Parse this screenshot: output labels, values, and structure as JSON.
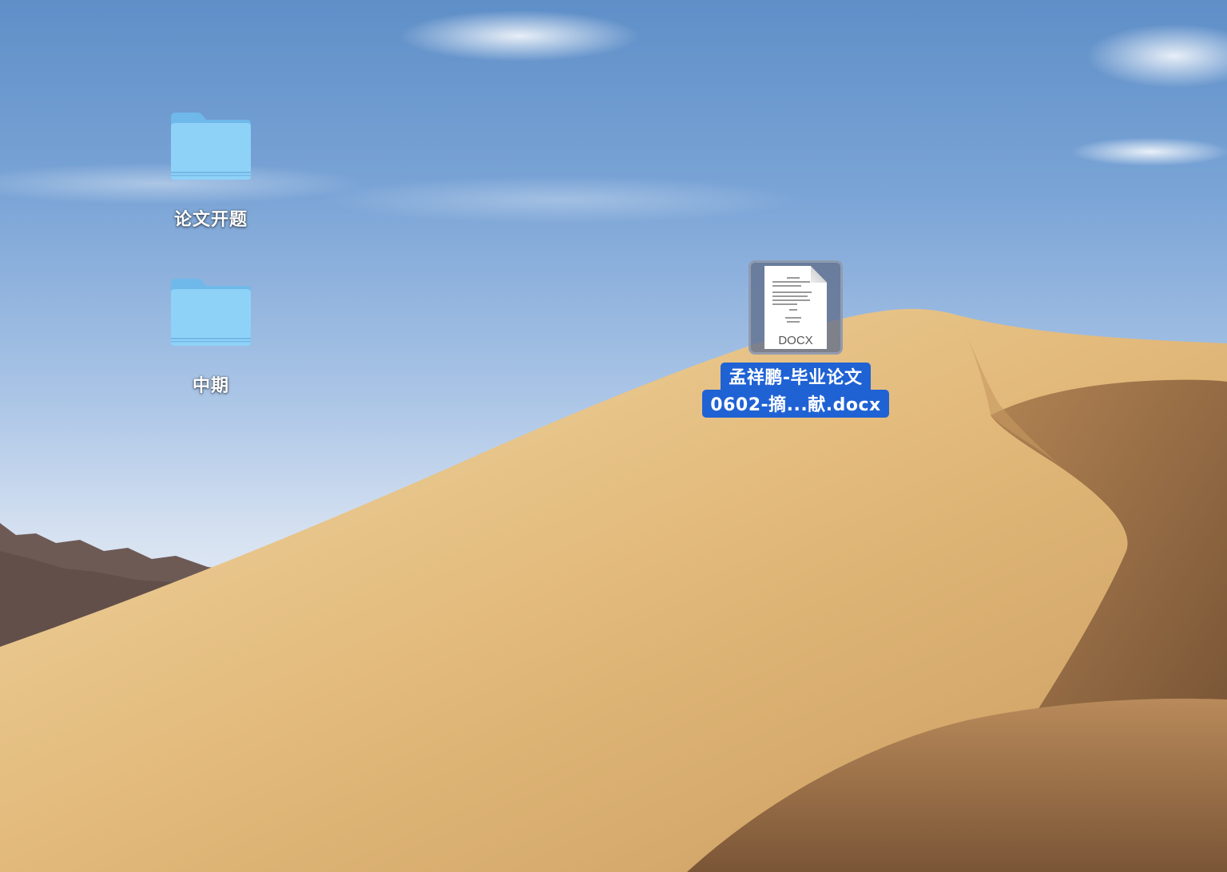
{
  "desktop": {
    "icons": [
      {
        "label": "论文开题",
        "kind": "folder-icon"
      },
      {
        "label": "中期",
        "kind": "folder-icon"
      },
      {
        "label_line1": "孟祥鹏-毕业论文",
        "label_line2": "0602-摘...献.docx",
        "kind": "document-icon",
        "thumbnail_ext": "DOCX",
        "selected": true
      }
    ]
  },
  "colors": {
    "folder": "#86cdf6",
    "selection": "#1f62d4"
  }
}
